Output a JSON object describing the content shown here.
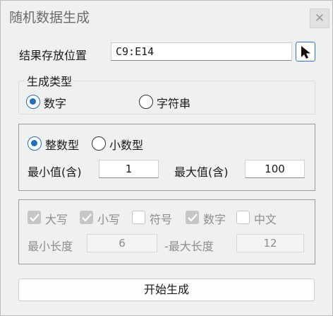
{
  "window": {
    "title": "随机数据生成",
    "close_symbol": "✕"
  },
  "result": {
    "label": "结果存放位置",
    "value": "C9:E14",
    "picker_icon": "cursor-arrow-icon"
  },
  "gen_type": {
    "legend": "生成类型",
    "options": [
      {
        "label": "数字",
        "checked": true
      },
      {
        "label": "字符串",
        "checked": false
      }
    ]
  },
  "number": {
    "types": [
      {
        "label": "整数型",
        "checked": true
      },
      {
        "label": "小数型",
        "checked": false
      }
    ],
    "min_label": "最小值(含)",
    "min_value": "1",
    "max_label": "最大值(含)",
    "max_value": "100"
  },
  "string": {
    "charsets": [
      {
        "label": "大写",
        "checked": true
      },
      {
        "label": "小写",
        "checked": true
      },
      {
        "label": "符号",
        "checked": false
      },
      {
        "label": "数字",
        "checked": true
      },
      {
        "label": "中文",
        "checked": false
      }
    ],
    "min_len_label": "最小长度",
    "min_len_value": "6",
    "max_len_label": "-最大长度",
    "max_len_value": "12"
  },
  "actions": {
    "generate_label": "开始生成"
  },
  "colors": {
    "accent": "#1f6fc0",
    "picker_border": "#2f78c4",
    "disabled_text": "#8e8e8e"
  }
}
